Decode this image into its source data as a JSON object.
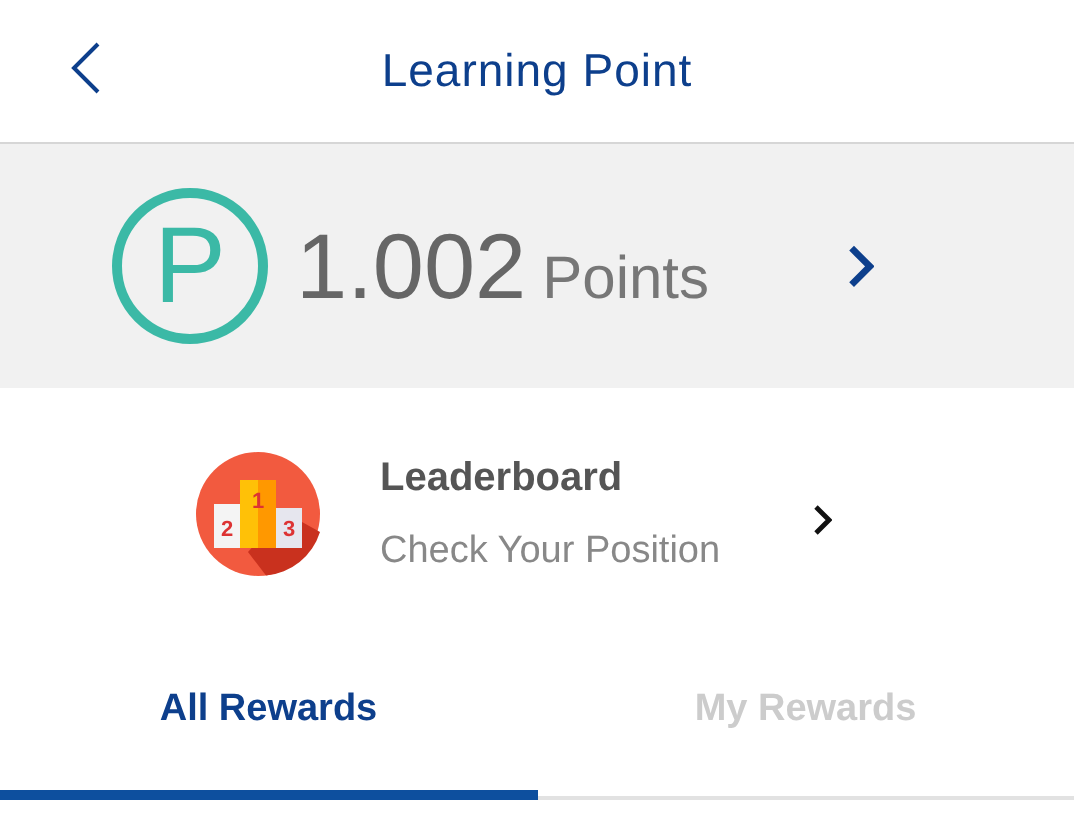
{
  "header": {
    "title": "Learning Point"
  },
  "points": {
    "badge": "P",
    "value": "1.002",
    "unit": "Points"
  },
  "leaderboard": {
    "podium": [
      "2",
      "1",
      "3"
    ],
    "title": "Leaderboard",
    "subtitle": "Check Your Position"
  },
  "tabs": [
    {
      "label": "All Rewards",
      "selected": true
    },
    {
      "label": "My Rewards",
      "selected": false
    }
  ]
}
